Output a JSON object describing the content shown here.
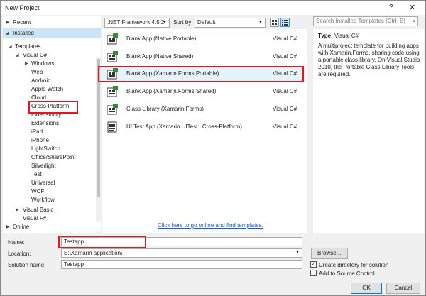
{
  "window": {
    "title": "New Project",
    "help_glyph": "?",
    "close_glyph": "✕"
  },
  "sidebar": {
    "recent": "Recent",
    "installed": "Installed",
    "templates": "Templates",
    "visual_csharp": "Visual C#",
    "items": [
      "Windows",
      "Web",
      "Android",
      "Apple Watch",
      "Cloud",
      "Cross-Platform",
      "Extensibility",
      "Extensions",
      "iPad",
      "iPhone",
      "LightSwitch",
      "Office/SharePoint",
      "Silverlight",
      "Test",
      "Universal",
      "WCF",
      "Workflow"
    ],
    "visual_basic": "Visual Basic",
    "visual_fsharp": "Visual F#",
    "online": "Online"
  },
  "toolbar": {
    "framework": ".NET Framework 4.5.2",
    "sort_by_label": "Sort by:",
    "sort_value": "Default",
    "search_placeholder": "Search Installed Templates (Ctrl+E)"
  },
  "templates": [
    {
      "name": "Blank App (Native Portable)",
      "lang": "Visual C#"
    },
    {
      "name": "Blank App (Native Shared)",
      "lang": "Visual C#"
    },
    {
      "name": "Blank App (Xamarin.Forms Portable)",
      "lang": "Visual C#"
    },
    {
      "name": "Blank App (Xamarin.Forms Shared)",
      "lang": "Visual C#"
    },
    {
      "name": "Class Library (Xamarin.Forms)",
      "lang": "Visual C#"
    },
    {
      "name": "UI Test App (Xamarin.UITest | Cross-Platform)",
      "lang": "Visual C#"
    }
  ],
  "online_link": "Click here to go online and find templates.",
  "description": {
    "type_label": "Type:",
    "type_value": "Visual C#",
    "text": "A multiproject template for building apps with Xamarin.Forms, sharing code using a portable class library. On Visual Studio 2010, the Portable Class Library Tools are required."
  },
  "form": {
    "name_label": "Name:",
    "name_value": "Testapp",
    "location_label": "Location:",
    "location_value": "E:\\Xamarin application\\",
    "solution_label": "Solution name:",
    "solution_value": "Testapp",
    "browse": "Browse...",
    "create_dir": "Create directory for solution",
    "add_source": "Add to Source Control",
    "ok": "OK",
    "cancel": "Cancel"
  },
  "colors": {
    "highlight_box": "#e2171f",
    "selection": "#e5f3fb",
    "link": "#1a5dc8"
  }
}
